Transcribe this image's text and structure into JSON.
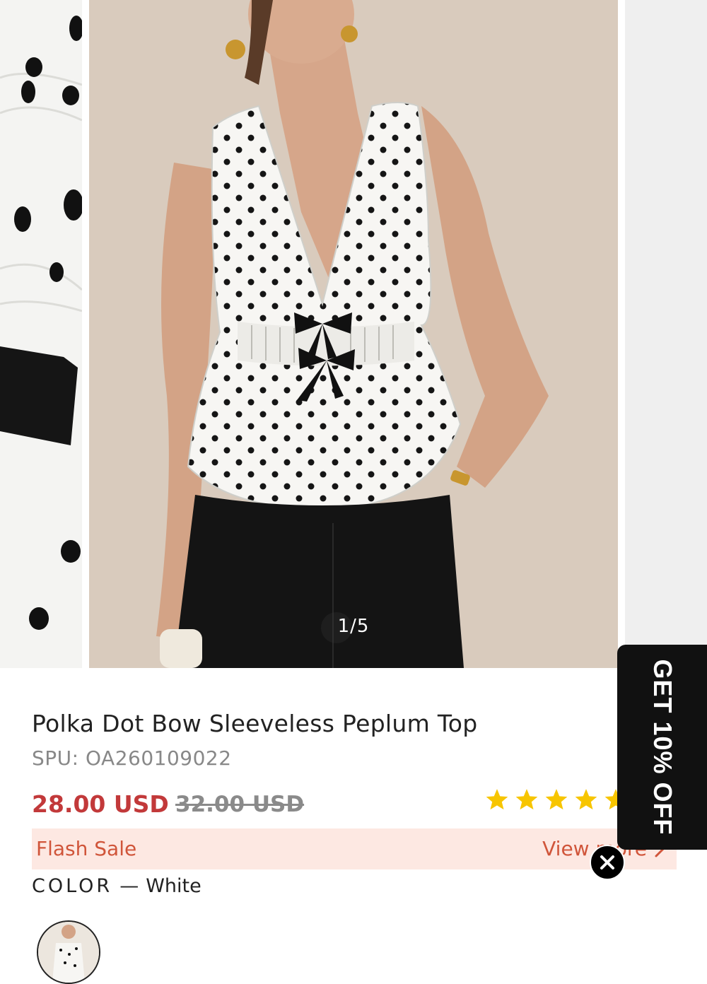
{
  "gallery": {
    "counter": "1/5",
    "current_index": 1,
    "total": 5
  },
  "product": {
    "title": "Polka Dot Bow Sleeveless Peplum Top",
    "spu": "SPU: OA260109022",
    "price": "28.00 USD",
    "original_price": "32.00 USD",
    "rating_stars": 5
  },
  "flash_sale": {
    "label": "Flash Sale",
    "link": "View more"
  },
  "color": {
    "label": "COLOR",
    "separator": "—",
    "value": "White"
  },
  "promo": {
    "tab_text": "GET 10% OFF"
  },
  "colors": {
    "price": "#c2393a",
    "flash_bg": "#fde8e2",
    "flash_text": "#d0553a",
    "star": "#f7c500",
    "promo_bg": "#111111"
  }
}
